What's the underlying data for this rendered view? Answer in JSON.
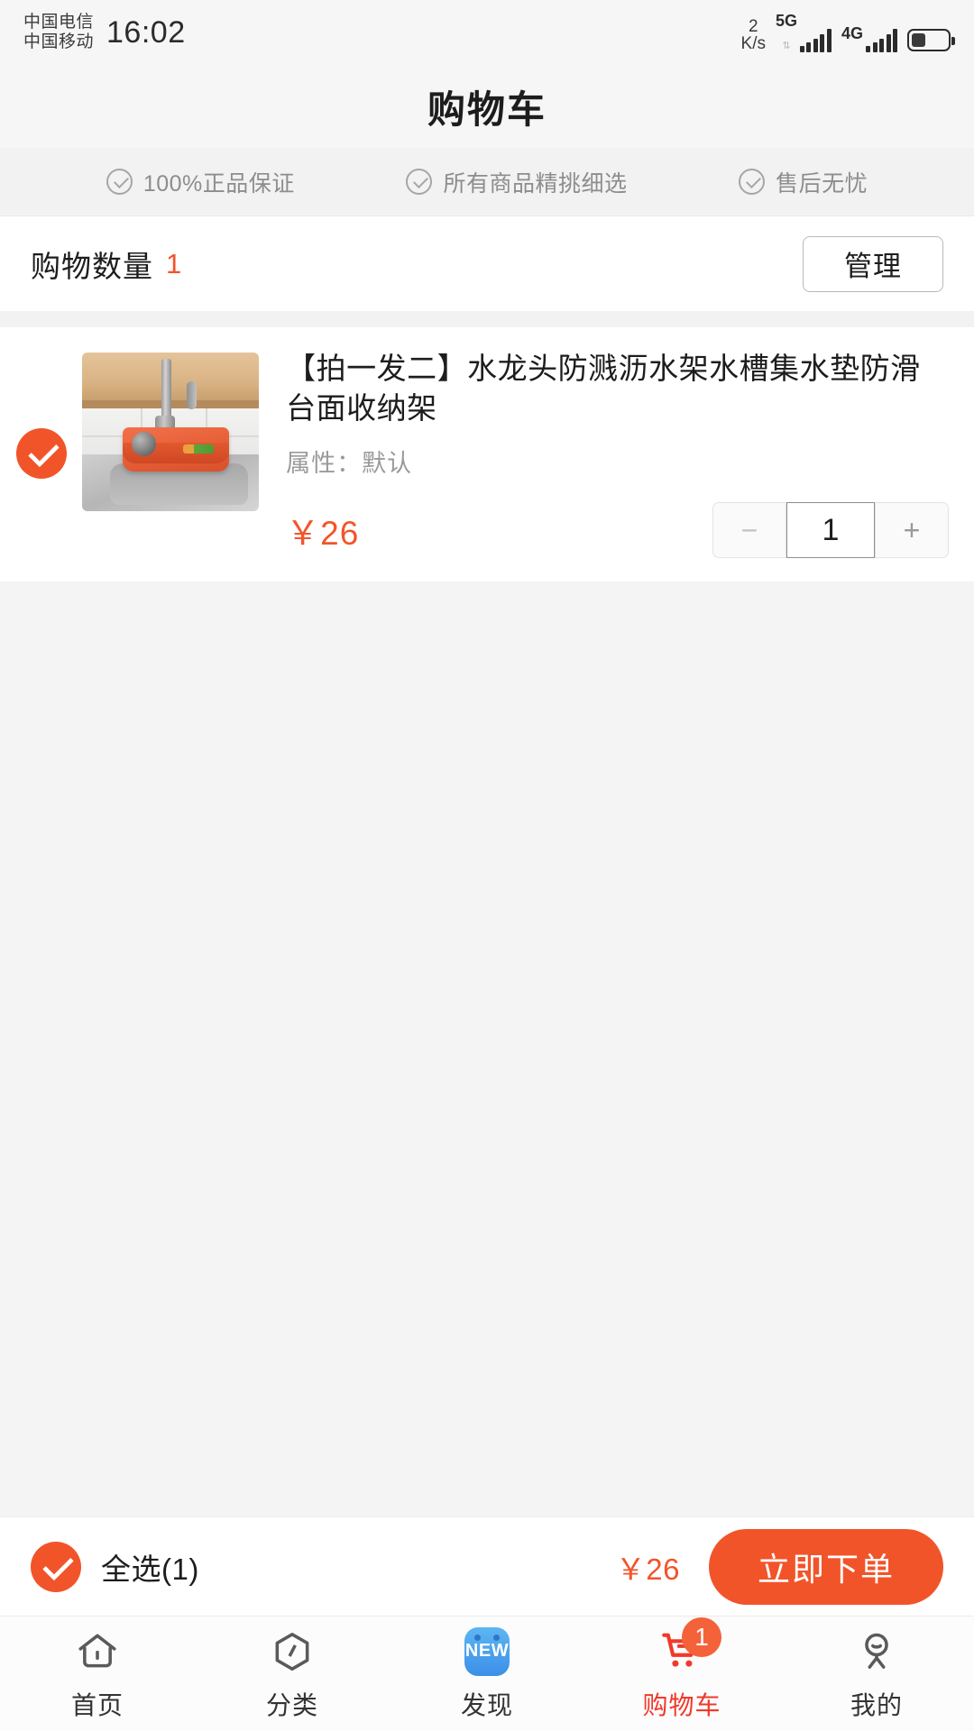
{
  "status_bar": {
    "carrier_1": "中国电信",
    "carrier_2": "中国移动",
    "time": "16:02",
    "net_speed_value": "2",
    "net_speed_unit": "K/s",
    "signal_1_label": "5G",
    "signal_2_label": "4G",
    "battery_level_percent": "40"
  },
  "header": {
    "title": "购物车"
  },
  "trust_banner": {
    "items": [
      {
        "icon": "circle-check-icon",
        "label": "100%正品保证"
      },
      {
        "icon": "circle-check-icon",
        "label": "所有商品精挑细选"
      },
      {
        "icon": "circle-check-icon",
        "label": "售后无忧"
      }
    ]
  },
  "count_row": {
    "label": "购物数量",
    "count": "1",
    "manage_label": "管理"
  },
  "cart": {
    "items": [
      {
        "selected": true,
        "title": "【拍一发二】水龙头防溅沥水架水槽集水垫防滑台面收纳架",
        "attribute_label": "属性：",
        "attribute_value": "默认",
        "price": "￥26",
        "quantity": "1",
        "minus_label": "−",
        "plus_label": "+",
        "image_alt": "橙色硅胶水龙头防溅沥水架"
      }
    ]
  },
  "action_bar": {
    "select_all_label": "全选(1)",
    "select_all_checked": true,
    "total_price": "￥26",
    "order_button_label": "立即下单"
  },
  "tab_bar": {
    "tabs": [
      {
        "icon": "home-icon",
        "label": "首页",
        "active": false
      },
      {
        "icon": "category-hexagon-icon",
        "label": "分类",
        "active": false
      },
      {
        "icon": "new-badge-icon",
        "label": "发现",
        "active": false,
        "icon_text": "NEW"
      },
      {
        "icon": "shopping-cart-icon",
        "label": "购物车",
        "active": true,
        "badge": "1"
      },
      {
        "icon": "person-icon",
        "label": "我的",
        "active": false
      }
    ]
  },
  "colors": {
    "accent_orange": "#f2542a",
    "cart_red": "#f0392b",
    "new_blue": "#3d8fe8",
    "muted_gray": "#9a9a9a"
  }
}
